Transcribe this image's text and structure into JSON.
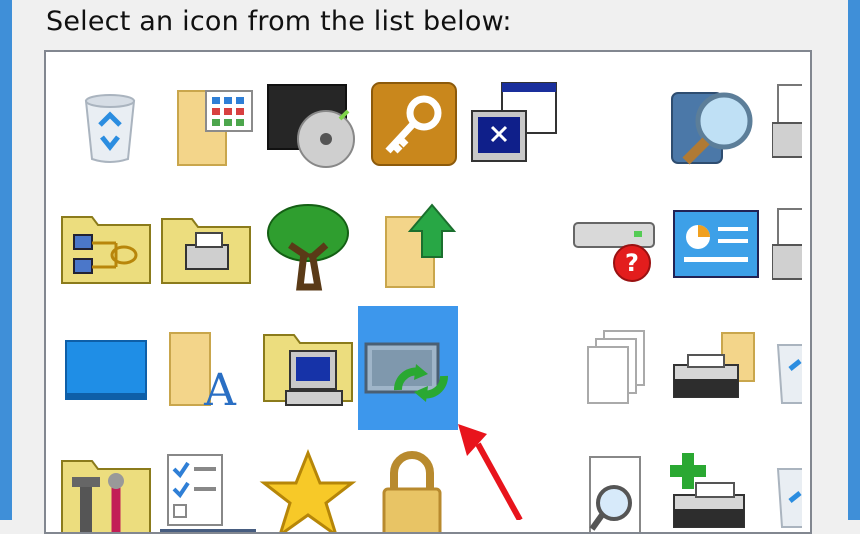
{
  "dialog": {
    "prompt": "Select an icon from the list below:"
  },
  "colors": {
    "selection": "#3d97ec",
    "window_border": "#3f8fd8",
    "annotation_arrow": "#e8141c"
  },
  "icons": [
    "recycle-bin-icon",
    "folder-grid-icon",
    "dvd-drive-icon",
    "key-icon",
    "monitor-window-icon",
    "search-globe-icon",
    "printer-icon",
    "network-folder-icon",
    "printer-folder-icon",
    "tree-icon",
    "upload-folder-icon",
    "drive-help-icon",
    "control-panel-icon",
    "printer-icon-2",
    "blue-desktop-icon",
    "font-folder-icon",
    "computer-folder-icon",
    "sync-monitor-icon",
    "documents-icon",
    "fax-folder-icon",
    "recycle-bin-icon-2",
    "tools-folder-icon",
    "checklist-icon",
    "star-icon",
    "lock-icon",
    "search-document-icon",
    "add-printer-icon",
    "recycle-bin-icon-3"
  ],
  "selected_icon": "sync-monitor-icon"
}
